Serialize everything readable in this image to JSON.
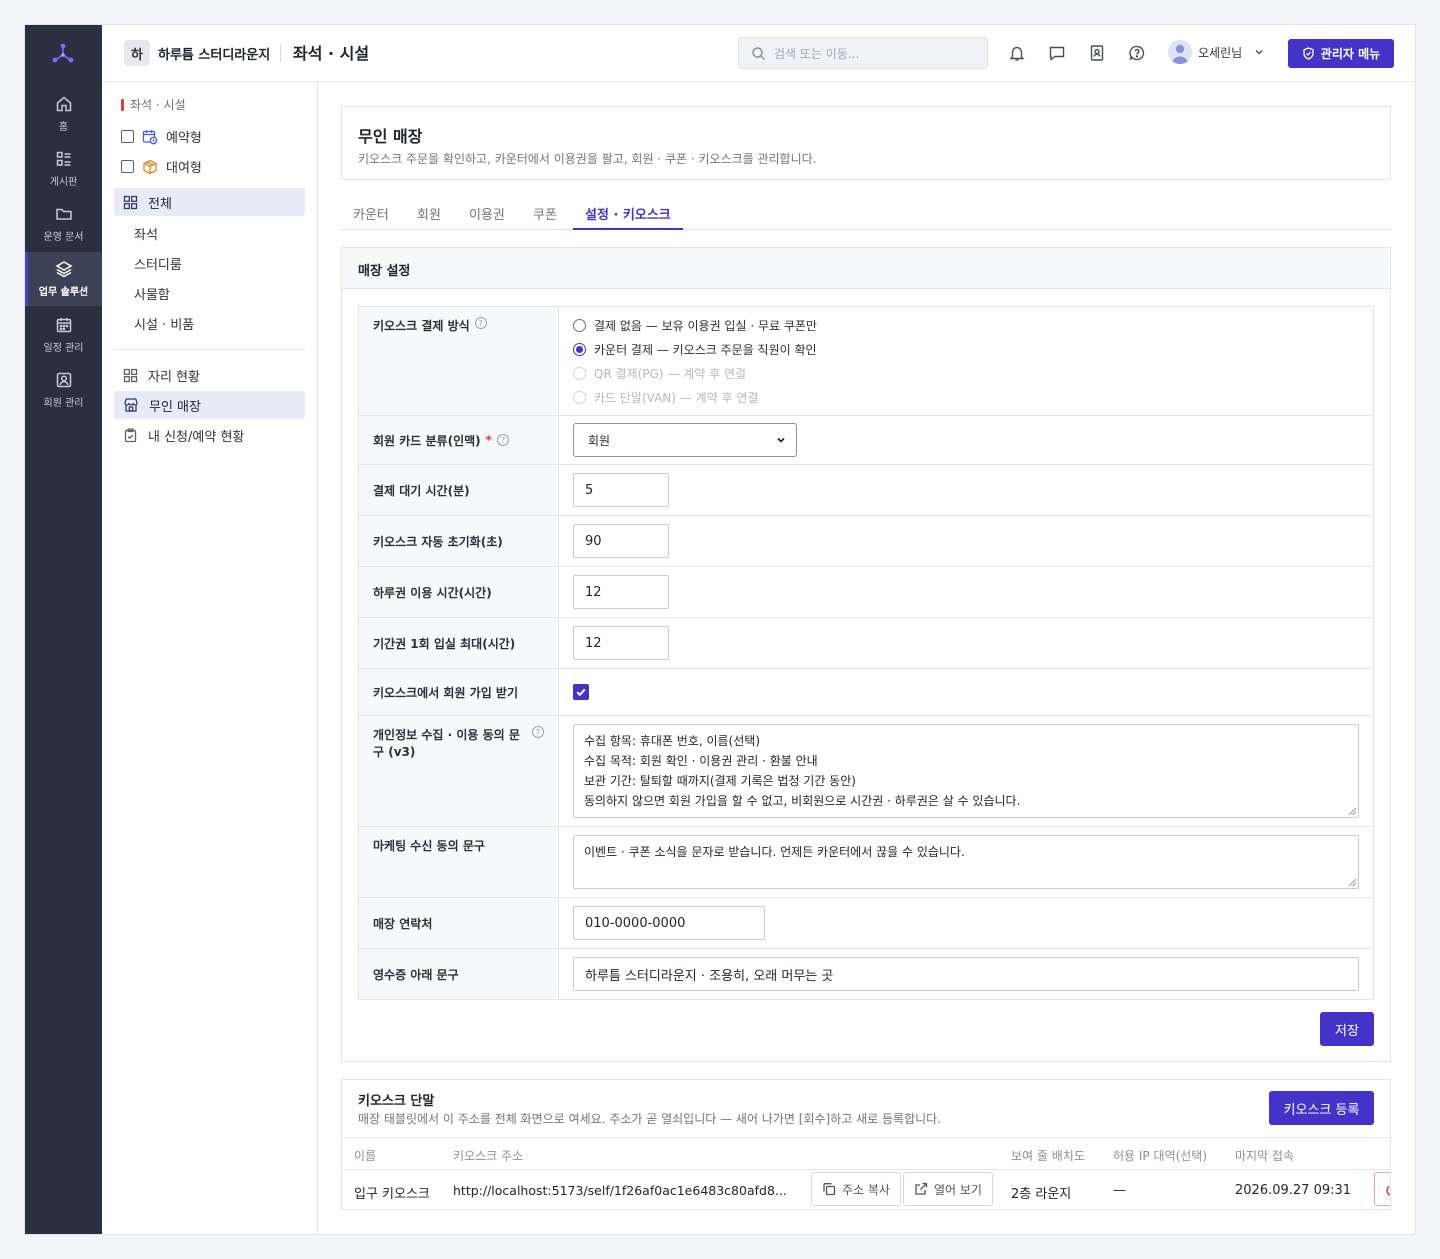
{
  "rail": {
    "items": [
      {
        "label": "홈",
        "icon": "home-icon"
      },
      {
        "label": "게시판",
        "icon": "board-icon"
      },
      {
        "label": "운영 문서",
        "icon": "folder-icon"
      },
      {
        "label": "업무 솔루션",
        "icon": "layers-icon"
      },
      {
        "label": "일정 관리",
        "icon": "calendar-icon"
      },
      {
        "label": "회원 관리",
        "icon": "member-icon"
      }
    ],
    "active_index": 3
  },
  "topbar": {
    "workspace_badge": "하",
    "workspace_name": "하루틈 스터디라운지",
    "page_title": "좌석 · 시설",
    "search_placeholder": "검색 또는 이동...",
    "user_name": "오세린님",
    "admin_button": "관리자 메뉴"
  },
  "subnav": {
    "heading": "좌석 · 시설",
    "filters": [
      {
        "label": "예약형",
        "checked": false
      },
      {
        "label": "대여형",
        "checked": false
      }
    ],
    "all_label": "전체",
    "categories": [
      "좌석",
      "스터디룸",
      "사물함",
      "시설 · 비품"
    ],
    "seat_status": "자리 현황",
    "unmanned_store": "무인 매장",
    "my_requests": "내 신청/예약 현황"
  },
  "page": {
    "title": "무인 매장",
    "description": "키오스크 주문을 확인하고, 카운터에서 이용권을 팔고, 회원 · 쿠폰 · 키오스크를 관리합니다.",
    "tabs": [
      "카운터",
      "회원",
      "이용권",
      "쿠폰",
      "설정 · 키오스크"
    ],
    "active_tab": 4
  },
  "settings": {
    "section_title": "매장 설정",
    "payment_label": "키오스크 결제 방식",
    "payment_options": [
      {
        "label": "결제 없음 — 보유 이용권 입실 · 무료 쿠폰만",
        "selected": false,
        "disabled": false
      },
      {
        "label": "카운터 결제 — 키오스크 주문을 직원이 확인",
        "selected": true,
        "disabled": false
      },
      {
        "label": "QR 결제(PG) — 계약 후 연결",
        "selected": false,
        "disabled": true
      },
      {
        "label": "카드 단말(VAN) — 계약 후 연결",
        "selected": false,
        "disabled": true
      }
    ],
    "member_card_label": "회원 카드 분류(인맥)",
    "member_card_required": "*",
    "member_card_value": "회원",
    "wait_label": "결제 대기 시간(분)",
    "wait_value": "5",
    "reset_label": "키오스크 자동 초기화(초)",
    "reset_value": "90",
    "daypass_label": "하루권 이용 시간(시간)",
    "daypass_value": "12",
    "period_label": "기간권 1회 입실 최대(시간)",
    "period_value": "12",
    "signup_label": "키오스크에서 회원 가입 받기",
    "signup_checked": true,
    "privacy_label": "개인정보 수집 · 이용 동의 문구 (v3)",
    "privacy_lines": [
      "수집 항목: 휴대폰 번호, 이름(선택)",
      "수집 목적: 회원 확인 · 이용권 관리 · 환불 안내",
      "보관 기간: 탈퇴할 때까지(결제 기록은 법정 기간 동안)",
      "동의하지 않으면 회원 가입을 할 수 없고, 비회원으로 시간권 · 하루권은 살 수 있습니다."
    ],
    "marketing_label": "마케팅 수신 동의 문구",
    "marketing_text": "이벤트 · 쿠폰 소식을 문자로 받습니다. 언제든 카운터에서 끊을 수 있습니다.",
    "contact_label": "매장 연락처",
    "contact_value": "010-0000-0000",
    "receipt_label": "영수증 아래 문구",
    "receipt_value": "하루틈 스터디라운지 · 조용히, 오래 머무는 곳",
    "save_button": "저장"
  },
  "kiosk": {
    "title": "키오스크 단말",
    "description": "매장 태블릿에서 이 주소를 전체 화면으로 여세요. 주소가 곧 열쇠입니다 — 새어 나가면 [회수]하고 새로 등록합니다.",
    "register_button": "키오스크 등록",
    "columns": [
      "이름",
      "키오스크 주소",
      "보여 줄 배치도",
      "허용 IP 대역(선택)",
      "마지막 접속"
    ],
    "rows": [
      {
        "name": "입구 키오스크",
        "url": "http://localhost:5173/self/1f26af0ac1e6483c80afd8...",
        "copy_button": "주소 복사",
        "open_button": "열어 보기",
        "layout": "2층 라운지",
        "ip": "—",
        "last_seen": "2026.09.27 09:31"
      }
    ]
  },
  "colors": {
    "accent": "#4433c9",
    "rail_bg": "#2b3040",
    "danger": "#e23c3c"
  }
}
